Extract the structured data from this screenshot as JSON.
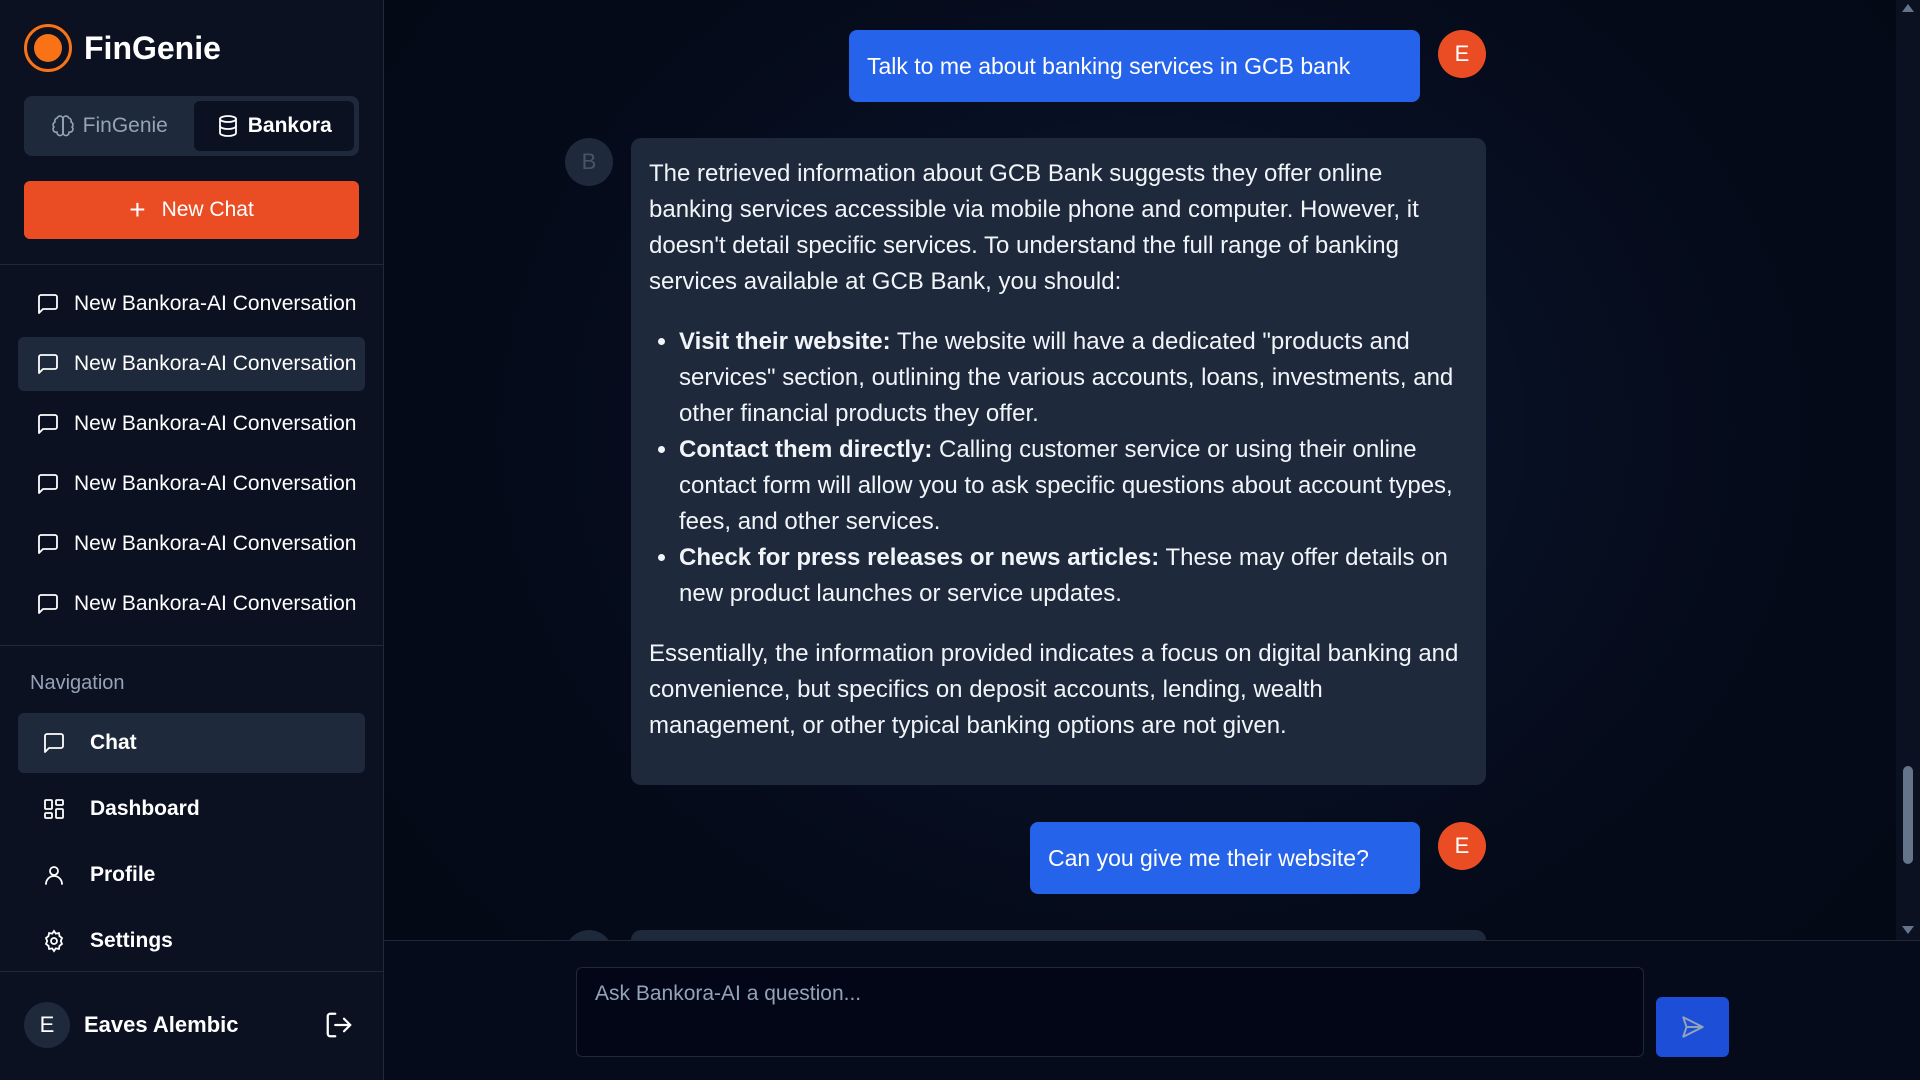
{
  "brand": {
    "name": "FinGenie"
  },
  "switcher": {
    "tabs": [
      "FinGenie",
      "Bankora"
    ],
    "active": "Bankora"
  },
  "sidebar": {
    "new_chat_label": "New Chat",
    "conversations": [
      "New Bankora-AI Conversation",
      "New Bankora-AI Conversation",
      "New Bankora-AI Conversation",
      "New Bankora-AI Conversation",
      "New Bankora-AI Conversation",
      "New Bankora-AI Conversation"
    ],
    "navigation_heading": "Navigation",
    "nav": [
      "Chat",
      "Dashboard",
      "Profile",
      "Settings"
    ],
    "user": {
      "initial": "E",
      "name": "Eaves Alembic"
    }
  },
  "chat": {
    "user_message_1": "Talk to me about banking services in GCB bank",
    "user_initial": "E",
    "bot_initial": "B",
    "bot_intro": "The retrieved information about GCB Bank suggests they offer online banking services accessible via mobile phone and computer. However, it doesn't detail specific services. To understand the full range of banking services available at GCB Bank, you should:",
    "bot_bullets": [
      {
        "bold": "Visit their website:",
        "text": " The website will have a dedicated \"products and services\" section, outlining the various accounts, loans, investments, and other financial products they offer."
      },
      {
        "bold": "Contact them directly:",
        "text": " Calling customer service or using their online contact form will allow you to ask specific questions about account types, fees, and other services."
      },
      {
        "bold": "Check for press releases or news articles:",
        "text": " These may offer details on new product launches or service updates."
      }
    ],
    "bot_conclusion": "Essentially, the information provided indicates a focus on digital banking and convenience, but specifics on deposit accounts, lending, wealth management, or other typical banking options are not given.",
    "user_message_2": "Can you give me their website?"
  },
  "composer": {
    "placeholder": "Ask Bankora-AI a question..."
  },
  "colors": {
    "accent": "#ea4d24",
    "user_bubble": "#2563eb",
    "send_button": "#1d4ed8"
  }
}
